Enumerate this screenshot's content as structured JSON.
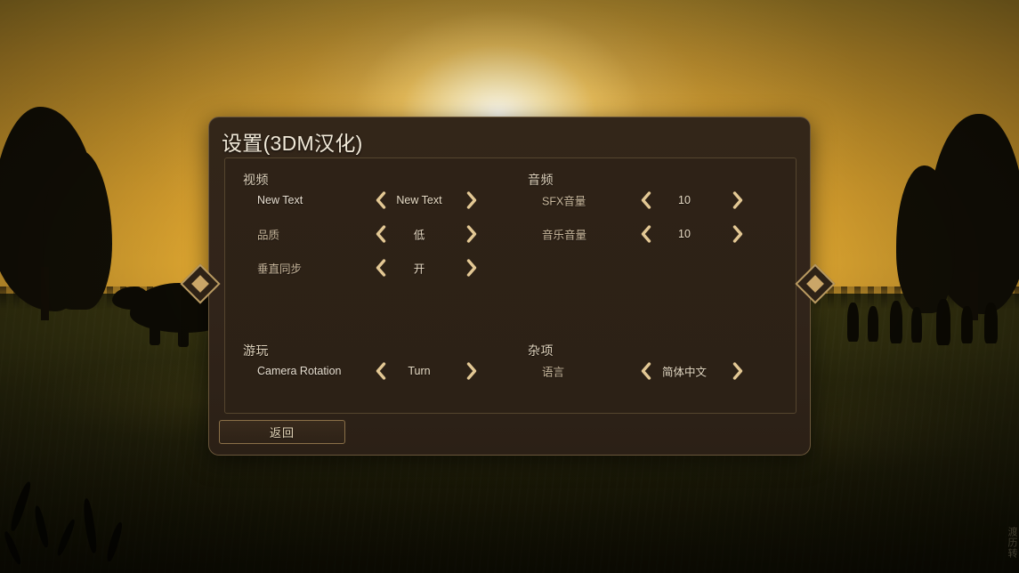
{
  "scene": {
    "description": "sunset-landscape-background",
    "watermark": "渡历转"
  },
  "dialog": {
    "title": "设置(3DM汉化)",
    "back_label": "返回"
  },
  "groups": [
    {
      "id": "video",
      "title": "视频",
      "column": "left",
      "position": "top",
      "rows": [
        {
          "label": "New Text",
          "value": "New Text",
          "bright": true
        },
        {
          "label": "品质",
          "value": "低",
          "bright": false
        },
        {
          "label": "垂直同步",
          "value": "开",
          "bright": false
        }
      ]
    },
    {
      "id": "audio",
      "title": "音频",
      "column": "right",
      "position": "top",
      "rows": [
        {
          "label": "SFX音量",
          "value": "10",
          "bright": false
        },
        {
          "label": "音乐音量",
          "value": "10",
          "bright": false
        }
      ]
    },
    {
      "id": "gameplay",
      "title": "游玩",
      "column": "left",
      "position": "bottom",
      "rows": [
        {
          "label": "Camera Rotation",
          "value": "Turn",
          "bright": true
        }
      ]
    },
    {
      "id": "misc",
      "title": "杂项",
      "column": "right",
      "position": "bottom",
      "rows": [
        {
          "label": "语言",
          "value": "简体中文",
          "bright": false
        }
      ]
    }
  ],
  "icons": {
    "prev": "chevron-left-icon",
    "next": "chevron-right-icon",
    "ornament": "diamond-ornament-icon"
  },
  "colors": {
    "panel_bg": "#31241a",
    "inner_bg": "#2d2217",
    "border": "#6a563a",
    "accent_gold": "#e3c894",
    "text_primary": "#e6dac4",
    "text_dim": "#c8b79c",
    "ornament_gold": "#caa668",
    "sky_top": "#b08a2a",
    "sky_mid": "#dba430",
    "ground": "#2d2b0d"
  }
}
